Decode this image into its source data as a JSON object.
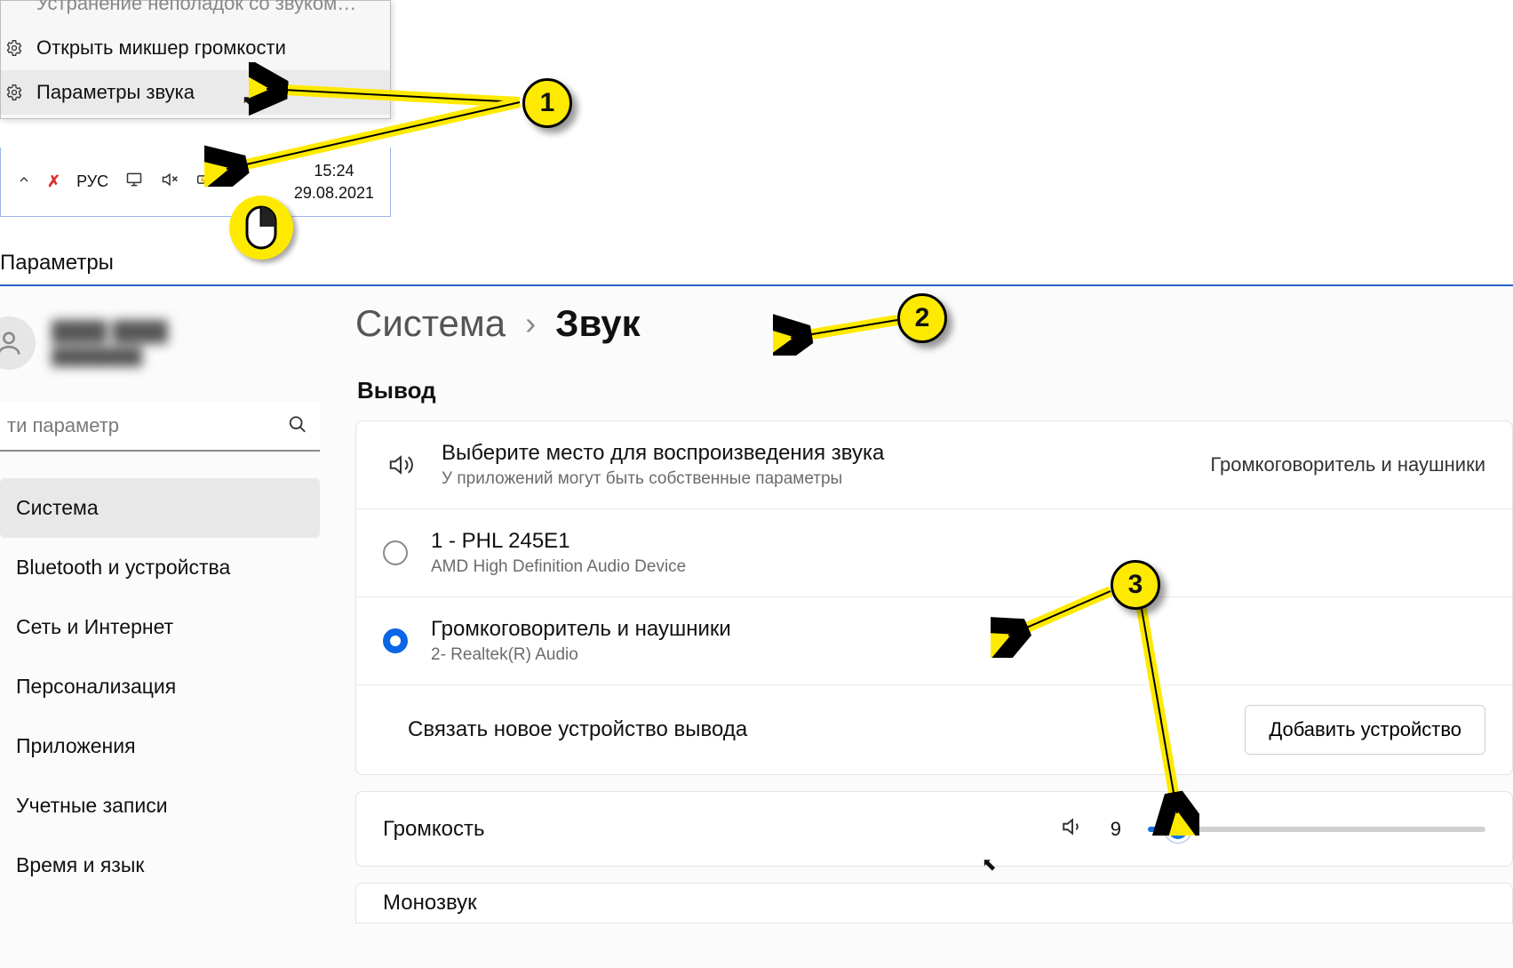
{
  "context_menu": {
    "item0": "Устранение неполадок со звуком…",
    "item1": "Открыть микшер громкости",
    "item2": "Параметры звука"
  },
  "tray": {
    "lang": "РУС",
    "time": "15:24",
    "date": "29.08.2021"
  },
  "settings": {
    "window_title": "Параметры",
    "search_placeholder": "ти параметр",
    "nav": {
      "system": "Система",
      "bluetooth": "Bluetooth и устройства",
      "network": "Сеть и Интернет",
      "personalization": "Персонализация",
      "apps": "Приложения",
      "accounts": "Учетные записи",
      "time_language": "Время и язык"
    },
    "breadcrumb": {
      "parent": "Система",
      "current": "Звук"
    },
    "output": {
      "section": "Вывод",
      "choose_title": "Выберите место для воспроизведения звука",
      "choose_sub": "У приложений могут быть собственные параметры",
      "current_device": "Громкоговоритель и наушники",
      "dev1_name": "1 - PHL 245E1",
      "dev1_sub": "AMD High Definition Audio Device",
      "dev2_name": "Громкоговоритель и наушники",
      "dev2_sub": "2- Realtek(R) Audio",
      "pair_new": "Связать новое устройство вывода",
      "add_device_btn": "Добавить устройство"
    },
    "volume": {
      "label": "Громкость",
      "value": "9",
      "pct": 9
    },
    "mono": {
      "label": "Монозвук"
    }
  },
  "annotations": {
    "b1": "1",
    "b2": "2",
    "b3": "3"
  }
}
